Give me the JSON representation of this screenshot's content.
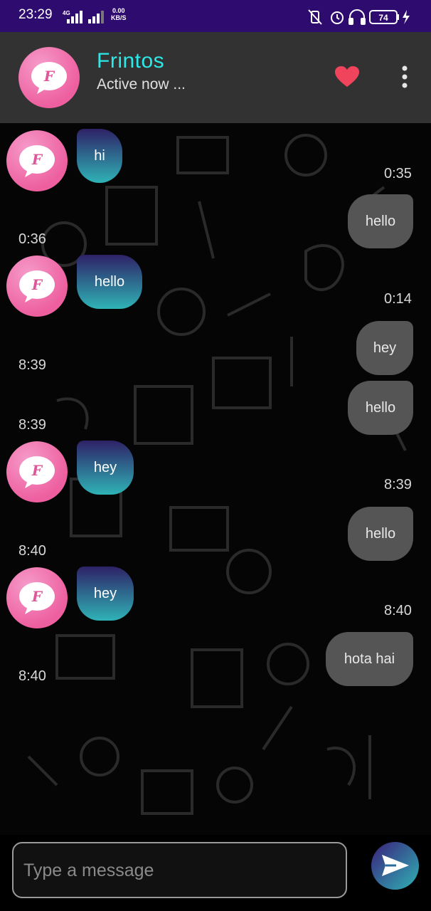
{
  "status_bar": {
    "time": "23:29",
    "network_type": "4G",
    "speed_value": "0.00",
    "speed_unit": "KB/S",
    "battery": "74"
  },
  "header": {
    "contact_name": "Frintos",
    "contact_status": "Active now ...",
    "avatar_icon": "app-logo-chat-bubble"
  },
  "messages": [
    {
      "direction": "incoming",
      "text": "hi",
      "time": "0:35"
    },
    {
      "direction": "outgoing",
      "text": "hello",
      "time": "0:36"
    },
    {
      "direction": "incoming",
      "text": "hello",
      "time": "0:14"
    },
    {
      "direction": "outgoing",
      "text": "hey",
      "time": "8:39"
    },
    {
      "direction": "outgoing",
      "text": "hello",
      "time": "8:39"
    },
    {
      "direction": "incoming",
      "text": "hey",
      "time": "8:39"
    },
    {
      "direction": "outgoing",
      "text": "hello",
      "time": "8:40"
    },
    {
      "direction": "incoming",
      "text": "hey",
      "time": "8:40"
    },
    {
      "direction": "outgoing",
      "text": "hota hai",
      "time": "8:40"
    }
  ],
  "composer": {
    "placeholder": "Type a message"
  },
  "colors": {
    "status_bar": "#2e0b6e",
    "header_bg": "#323232",
    "name_accent": "#2ee8e8",
    "heart": "#f0445c",
    "incoming_top": "#2e2166",
    "incoming_bottom": "#2fb3b6",
    "outgoing_bubble": "#555555"
  }
}
